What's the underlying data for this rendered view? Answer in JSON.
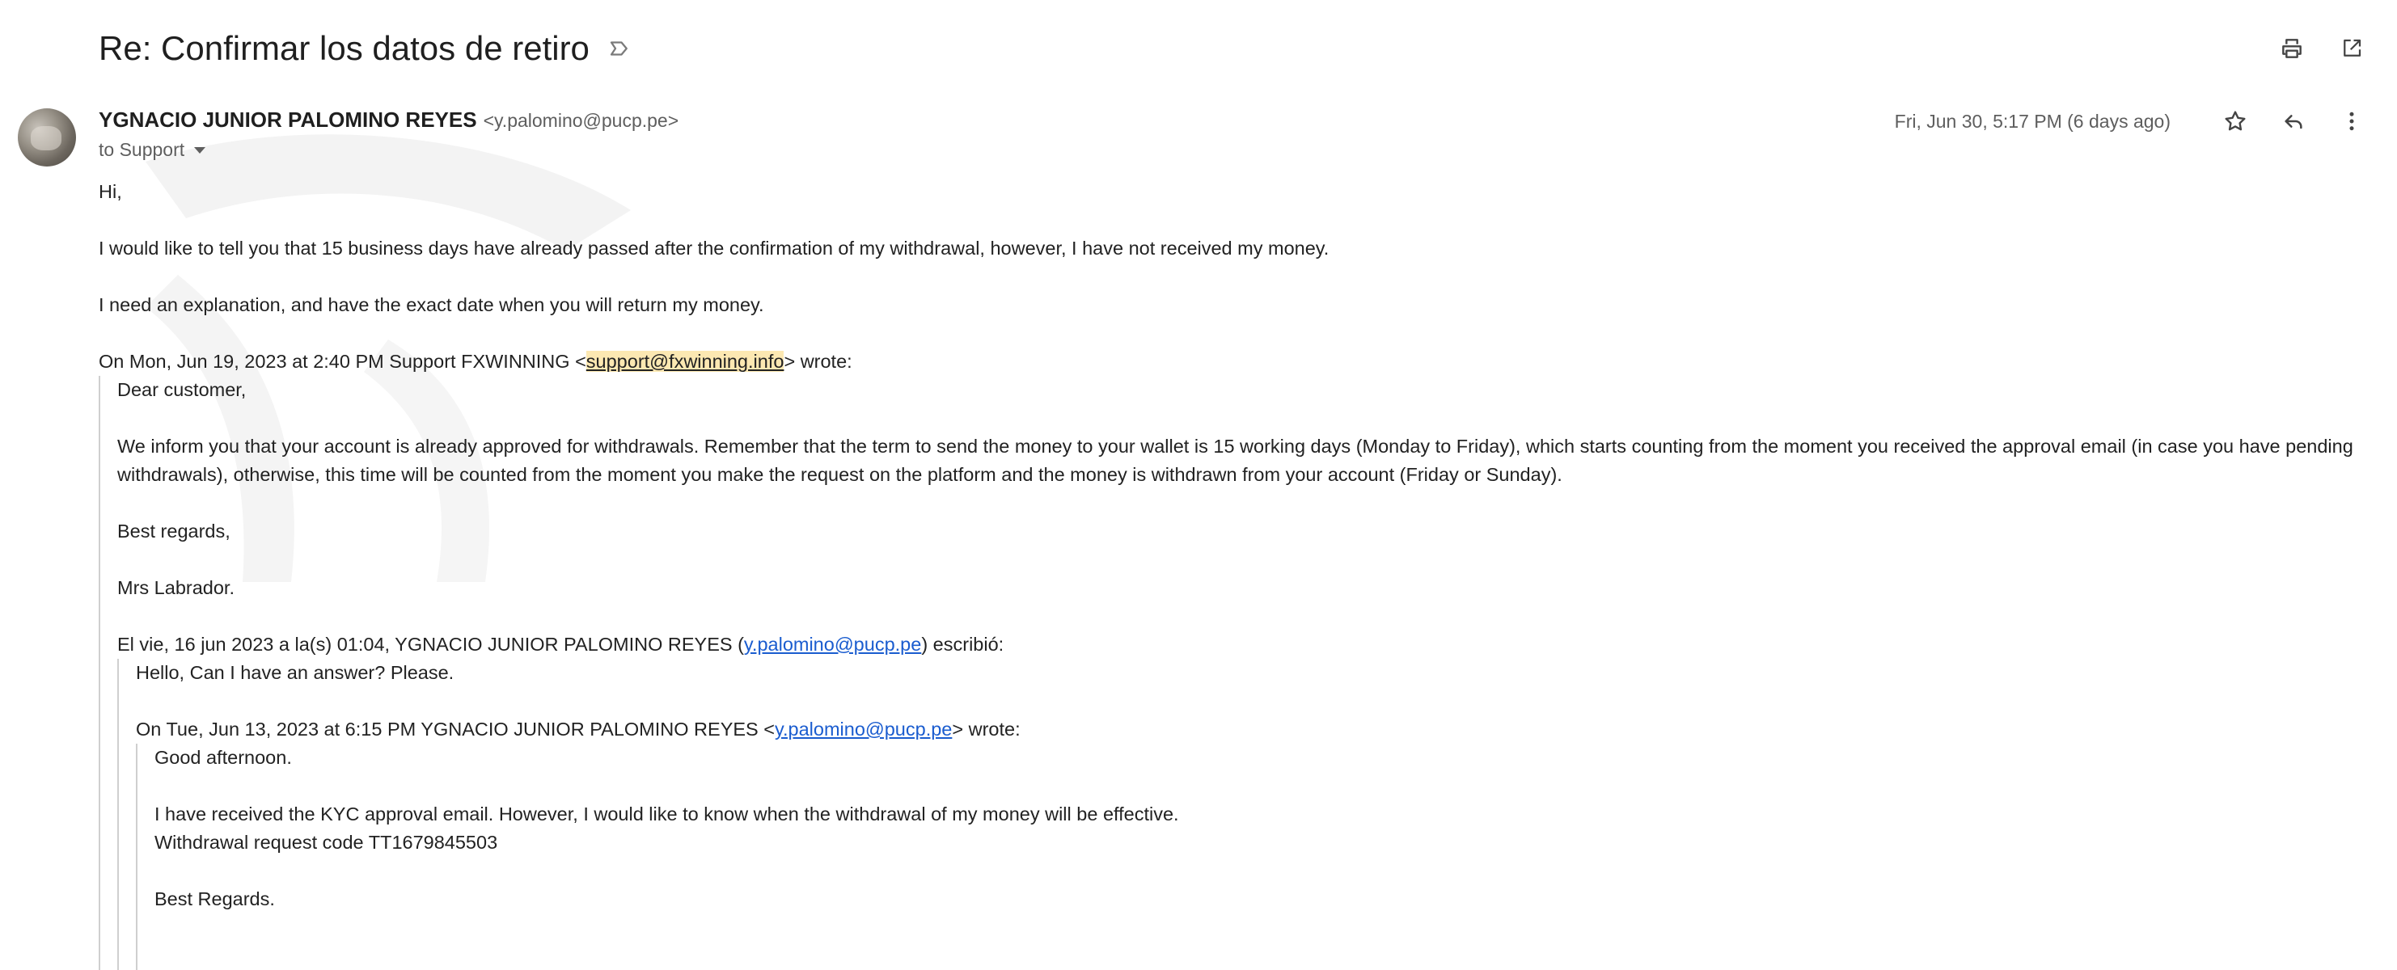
{
  "subject": "Re: Confirmar los datos de retiro",
  "icons": {
    "label": "label-icon",
    "print": "print-icon",
    "open_new_window": "open-in-new-window-icon",
    "star": "star-icon",
    "reply": "reply-icon",
    "more": "more-vert-icon"
  },
  "sender": {
    "name": "YGNACIO JUNIOR PALOMINO REYES",
    "email": "<y.palomino@pucp.pe>",
    "to": "to Support",
    "date": "Fri, Jun 30, 5:17 PM (6 days ago)"
  },
  "message": {
    "greeting": "Hi,",
    "line1": "I would like to tell you that 15 business days have already passed after the confirmation of my withdrawal, however, I have not received my money.",
    "line2": "I need an explanation, and have the exact date when you will return my money.",
    "quote1_header_pre": "On Mon, Jun 19, 2023 at 2:40 PM Support FXWINNING <",
    "quote1_header_link": "support@fxwinning.info",
    "quote1_header_post": "> wrote:",
    "quote1": {
      "greeting": "Dear customer,",
      "para": "We inform you that your account is already approved for withdrawals. Remember that the term to send the money to your wallet is 15 working days (Monday to Friday), which starts counting from the moment you received the approval email (in case you have pending withdrawals), otherwise, this time will be counted from the moment you make the request on the platform and the money is withdrawn from your account (Friday or Sunday).",
      "regards": "Best regards,",
      "sign": "Mrs Labrador.",
      "quote2_header_pre": "El vie, 16 jun 2023 a la(s) 01:04, YGNACIO JUNIOR PALOMINO REYES (",
      "quote2_header_link": "y.palomino@pucp.pe",
      "quote2_header_post": ") escribió:",
      "quote2": {
        "line": "Hello, Can I have an answer? Please.",
        "quote3_header_pre": "On Tue, Jun 13, 2023 at 6:15 PM YGNACIO JUNIOR PALOMINO REYES <",
        "quote3_header_link": "y.palomino@pucp.pe",
        "quote3_header_post": "> wrote:",
        "quote3": {
          "greeting": "Good afternoon.",
          "line1": "I have received the KYC approval email. However, I would like to know when the withdrawal of my money will be effective.",
          "line2": "Withdrawal request code TT1679845503",
          "regards": "Best Regards."
        }
      }
    }
  }
}
